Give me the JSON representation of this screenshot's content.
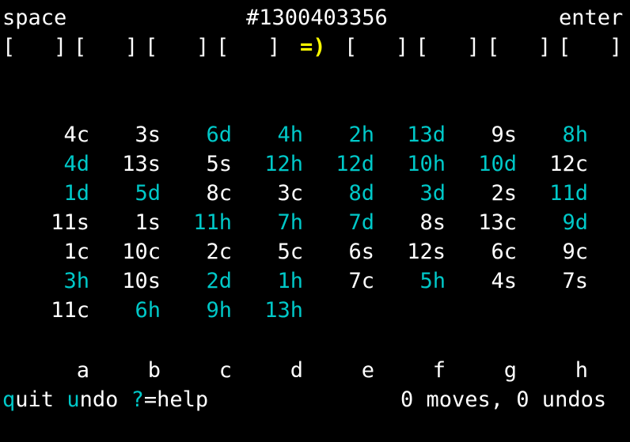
{
  "header": {
    "left_label": "space",
    "game_number": "#1300403356",
    "right_label": "enter"
  },
  "cells": {
    "free_cells": [
      "[   ]",
      "[   ]",
      "[   ]",
      "[   ]"
    ],
    "face": "=)",
    "foundations": [
      "[   ]",
      "[   ]",
      "[   ]",
      "[   ]"
    ]
  },
  "tableau": {
    "columns": [
      {
        "label": "a",
        "cards": [
          {
            "text": "4c",
            "color": "black"
          },
          {
            "text": "4d",
            "color": "red"
          },
          {
            "text": "1d",
            "color": "red"
          },
          {
            "text": "11s",
            "color": "black"
          },
          {
            "text": "1c",
            "color": "black"
          },
          {
            "text": "3h",
            "color": "red"
          },
          {
            "text": "11c",
            "color": "black"
          }
        ]
      },
      {
        "label": "b",
        "cards": [
          {
            "text": "3s",
            "color": "black"
          },
          {
            "text": "13s",
            "color": "black"
          },
          {
            "text": "5d",
            "color": "red"
          },
          {
            "text": "1s",
            "color": "black"
          },
          {
            "text": "10c",
            "color": "black"
          },
          {
            "text": "10s",
            "color": "black"
          },
          {
            "text": "6h",
            "color": "red"
          }
        ]
      },
      {
        "label": "c",
        "cards": [
          {
            "text": "6d",
            "color": "red"
          },
          {
            "text": "5s",
            "color": "black"
          },
          {
            "text": "8c",
            "color": "black"
          },
          {
            "text": "11h",
            "color": "red"
          },
          {
            "text": "2c",
            "color": "black"
          },
          {
            "text": "2d",
            "color": "red"
          },
          {
            "text": "9h",
            "color": "red"
          }
        ]
      },
      {
        "label": "d",
        "cards": [
          {
            "text": "4h",
            "color": "red"
          },
          {
            "text": "12h",
            "color": "red"
          },
          {
            "text": "3c",
            "color": "black"
          },
          {
            "text": "7h",
            "color": "red"
          },
          {
            "text": "5c",
            "color": "black"
          },
          {
            "text": "1h",
            "color": "red"
          },
          {
            "text": "13h",
            "color": "red"
          }
        ]
      },
      {
        "label": "e",
        "cards": [
          {
            "text": "2h",
            "color": "red"
          },
          {
            "text": "12d",
            "color": "red"
          },
          {
            "text": "8d",
            "color": "red"
          },
          {
            "text": "7d",
            "color": "red"
          },
          {
            "text": "6s",
            "color": "black"
          },
          {
            "text": "7c",
            "color": "black"
          }
        ]
      },
      {
        "label": "f",
        "cards": [
          {
            "text": "13d",
            "color": "red"
          },
          {
            "text": "10h",
            "color": "red"
          },
          {
            "text": "3d",
            "color": "red"
          },
          {
            "text": "8s",
            "color": "black"
          },
          {
            "text": "12s",
            "color": "black"
          },
          {
            "text": "5h",
            "color": "red"
          }
        ]
      },
      {
        "label": "g",
        "cards": [
          {
            "text": "9s",
            "color": "black"
          },
          {
            "text": "10d",
            "color": "red"
          },
          {
            "text": "2s",
            "color": "black"
          },
          {
            "text": "13c",
            "color": "black"
          },
          {
            "text": "6c",
            "color": "black"
          },
          {
            "text": "4s",
            "color": "black"
          }
        ]
      },
      {
        "label": "h",
        "cards": [
          {
            "text": "8h",
            "color": "red"
          },
          {
            "text": "12c",
            "color": "black"
          },
          {
            "text": "11d",
            "color": "red"
          },
          {
            "text": "9d",
            "color": "red"
          },
          {
            "text": "9c",
            "color": "black"
          },
          {
            "text": "7s",
            "color": "black"
          }
        ]
      }
    ]
  },
  "footer": {
    "quit_key": "q",
    "quit_rest": "uit",
    "undo_key": "u",
    "undo_rest": "ndo",
    "help_key": "?",
    "help_rest": "=help",
    "status": "0 moves, 0 undos"
  },
  "colors": {
    "background": "#000000",
    "black_suit": "#ffffff",
    "red_suit": "#00c8c8",
    "face": "#ffff00"
  }
}
